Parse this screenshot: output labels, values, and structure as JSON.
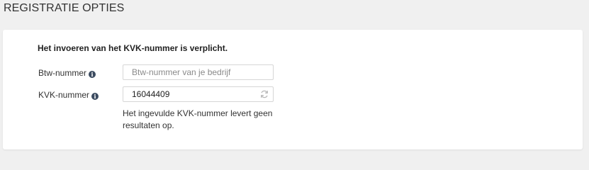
{
  "section": {
    "title": "REGISTRATIE OPTIES"
  },
  "form": {
    "notice": "Het invoeren van het KVK-nummer is verplicht.",
    "btw": {
      "label": "Btw-nummer",
      "value": "",
      "placeholder": "Btw-nummer van je bedrijf",
      "icon": "info-icon"
    },
    "kvk": {
      "label": "KVK-nummer",
      "value": "16044409",
      "placeholder": "",
      "icon": "info-icon",
      "action_icon": "refresh-icon"
    },
    "error_message": "Het ingevulde KVK-nummer levert geen resultaten op."
  },
  "colors": {
    "page_background": "#f0f0f0",
    "panel_background": "#ffffff",
    "info_icon": "#3a4a5f",
    "input_border": "#d6d6d6"
  }
}
